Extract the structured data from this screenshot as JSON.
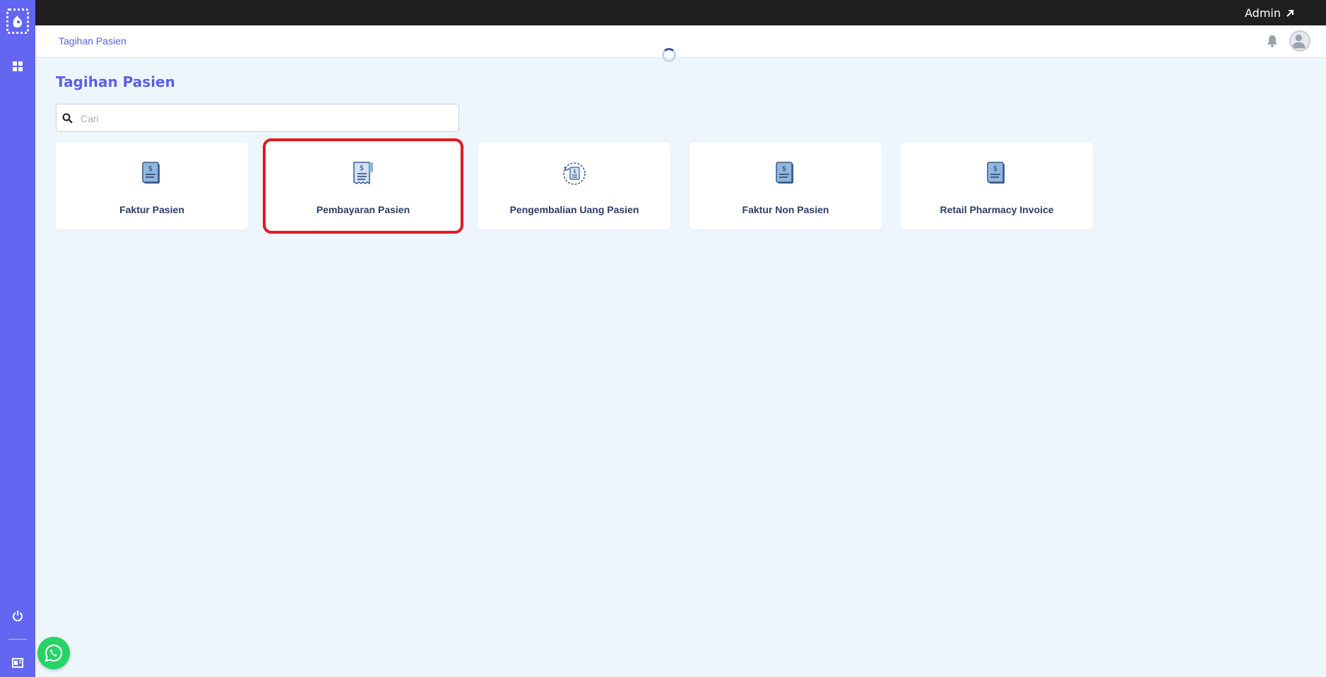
{
  "topbar": {
    "user_label": "Admin"
  },
  "header": {
    "breadcrumb": "Tagihan Pasien"
  },
  "main": {
    "page_title": "Tagihan Pasien",
    "search": {
      "placeholder": "Cari",
      "value": ""
    },
    "cards": [
      {
        "label": "Faktur Pasien",
        "icon": "invoice-icon"
      },
      {
        "label": "Pembayaran Pasien",
        "icon": "receipt-icon"
      },
      {
        "label": "Pengembalian Uang Pasien",
        "icon": "refund-icon"
      },
      {
        "label": "Faktur Non Pasien",
        "icon": "invoice-icon"
      },
      {
        "label": "Retail Pharmacy Invoice",
        "icon": "invoice-icon"
      }
    ]
  },
  "colors": {
    "sidebar": "#6366f1",
    "topbar": "#1f1f1f",
    "accent": "#5b5fe6",
    "highlight": "#e01b24",
    "background": "#eef6fd"
  }
}
